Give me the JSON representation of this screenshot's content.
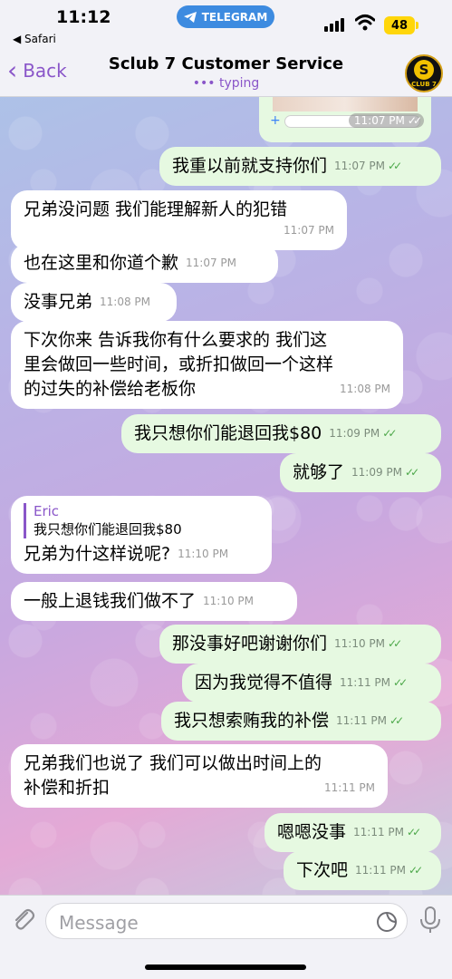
{
  "status_bar": {
    "time": "11:12",
    "back_app": "◀ Safari",
    "app_pill": "TELEGRAM",
    "battery": "48"
  },
  "header": {
    "back_label": "Back",
    "title": "Sclub 7 Customer Service",
    "subtitle": "typing",
    "avatar_letter": "S",
    "avatar_text": "CLUB 7"
  },
  "preview": {
    "time": "11:07 PM"
  },
  "messages": [
    {
      "dir": "out",
      "text": "我重以前就支持你们",
      "time": "11:07 PM"
    },
    {
      "dir": "in",
      "text": "兄弟没问题 我们能理解新人的犯错",
      "time": "11:07 PM"
    },
    {
      "dir": "in",
      "text": "也在这里和你道个歉",
      "time": "11:07 PM"
    },
    {
      "dir": "in",
      "text": "没事兄弟",
      "time": "11:08 PM"
    },
    {
      "dir": "in",
      "lines": [
        "下次你来 告诉我你有什么要求的 我们这",
        "里会做回一些时间，或折扣做回一个这样",
        "的过失的补偿给老板你"
      ],
      "time": "11:08 PM"
    },
    {
      "dir": "out",
      "text": "我只想你们能退回我$80",
      "time": "11:09 PM"
    },
    {
      "dir": "out",
      "text": "就够了",
      "time": "11:09 PM"
    },
    {
      "dir": "in",
      "reply_name": "Eric",
      "reply_text": "我只想你们能退回我$80",
      "text": "兄弟为什这样说呢?",
      "time": "11:10 PM"
    },
    {
      "dir": "in",
      "text": "一般上退钱我们做不了",
      "time": "11:10 PM"
    },
    {
      "dir": "out",
      "text": "那没事好吧谢谢你们",
      "time": "11:10 PM"
    },
    {
      "dir": "out",
      "text": "因为我觉得不值得",
      "time": "11:11 PM"
    },
    {
      "dir": "out",
      "text": "我只想索贿我的补偿",
      "time": "11:11 PM"
    },
    {
      "dir": "in",
      "lines": [
        "兄弟我们也说了 我们可以做出时间上的",
        "补偿和折扣"
      ],
      "time": "11:11 PM"
    },
    {
      "dir": "out",
      "text": "嗯嗯没事",
      "time": "11:11 PM"
    },
    {
      "dir": "out",
      "text": "下次吧",
      "time": "11:11 PM"
    }
  ],
  "input": {
    "placeholder": "Message"
  },
  "colors": {
    "accent": "#8a56c9",
    "outgoing_bubble": "#e6f9e1",
    "incoming_bubble": "#ffffff",
    "check": "#4da84a",
    "telegram_pill": "#3d8be0",
    "battery": "#ffd60a"
  }
}
